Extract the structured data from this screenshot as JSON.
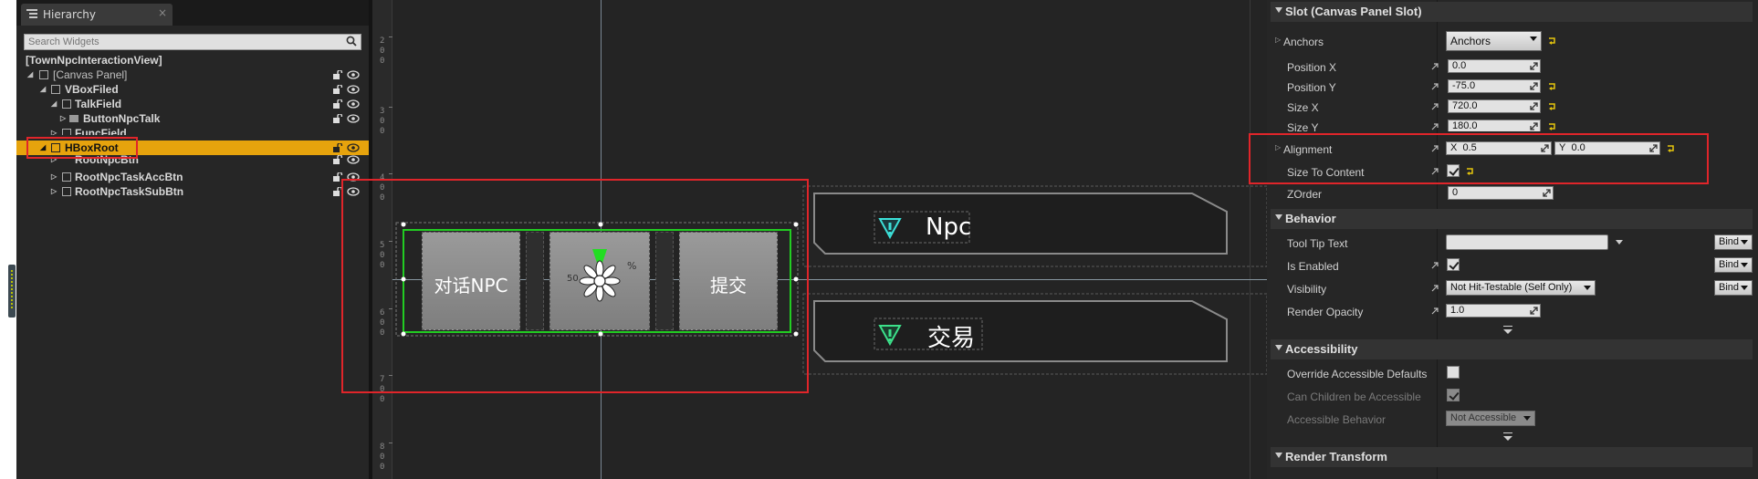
{
  "hierarchy": {
    "tab_label": "Hierarchy",
    "tab_close": "×",
    "search_placeholder": "Search Widgets",
    "items": [
      {
        "label": "[TownNpcInteractionView]"
      },
      {
        "label": "[Canvas Panel]"
      },
      {
        "label": "VBoxFiled"
      },
      {
        "label": "TalkField"
      },
      {
        "label": "ButtonNpcTalk"
      },
      {
        "label": "FuncField"
      },
      {
        "label": "HBoxRoot",
        "selected": true
      },
      {
        "label": "RootNpcBtn"
      },
      {
        "label": "RootNpcTaskAccBtn"
      },
      {
        "label": "RootNpcTaskSubBtn"
      }
    ],
    "selection_color": "#e6a30d"
  },
  "designer": {
    "ruler_ticks": [
      [
        "2",
        "0",
        "0"
      ],
      [
        "3",
        "0",
        "0"
      ],
      [
        "4",
        "0",
        "0"
      ],
      [
        "5",
        "0",
        "0"
      ],
      [
        "6",
        "0",
        "0"
      ],
      [
        "7",
        "0",
        "0"
      ],
      [
        "8",
        "0",
        "0"
      ]
    ],
    "hbox_buttons": [
      "对话NPC",
      "",
      "提交"
    ],
    "hidden_text": "50",
    "percent_text": "%",
    "npc_panel_label": "Npc",
    "trade_panel_label": "交易",
    "selection_color": "#22cc22",
    "highlight_color": "#e0252a"
  },
  "details": {
    "slot_header": "Slot (Canvas Panel Slot)",
    "anchors_label": "Anchors",
    "anchors_value": "Anchors",
    "position_x_label": "Position X",
    "position_x": "0.0",
    "position_y_label": "Position Y",
    "position_y": "-75.0",
    "size_x_label": "Size X",
    "size_x": "720.0",
    "size_y_label": "Size Y",
    "size_y": "180.0",
    "alignment_label": "Alignment",
    "alignment_x_prefix": "X",
    "alignment_x": "0.5",
    "alignment_y_prefix": "Y",
    "alignment_y": "0.0",
    "size_to_content_label": "Size To Content",
    "size_to_content": true,
    "zorder_label": "ZOrder",
    "zorder": "0",
    "behavior_header": "Behavior",
    "tooltip_label": "Tool Tip Text",
    "tooltip_value": "",
    "is_enabled_label": "Is Enabled",
    "is_enabled": true,
    "visibility_label": "Visibility",
    "visibility_value": "Not Hit-Testable (Self Only)",
    "render_opacity_label": "Render Opacity",
    "render_opacity": "1.0",
    "bind_label": "Bind",
    "accessibility_header": "Accessibility",
    "override_access_label": "Override Accessible Defaults",
    "override_access": false,
    "children_access_label": "Can Children be Accessible",
    "children_access": true,
    "access_behavior_label": "Accessible Behavior",
    "access_behavior_value": "Not Accessible",
    "render_transform_header": "Render Transform",
    "reset_color": "#e6c60d"
  }
}
